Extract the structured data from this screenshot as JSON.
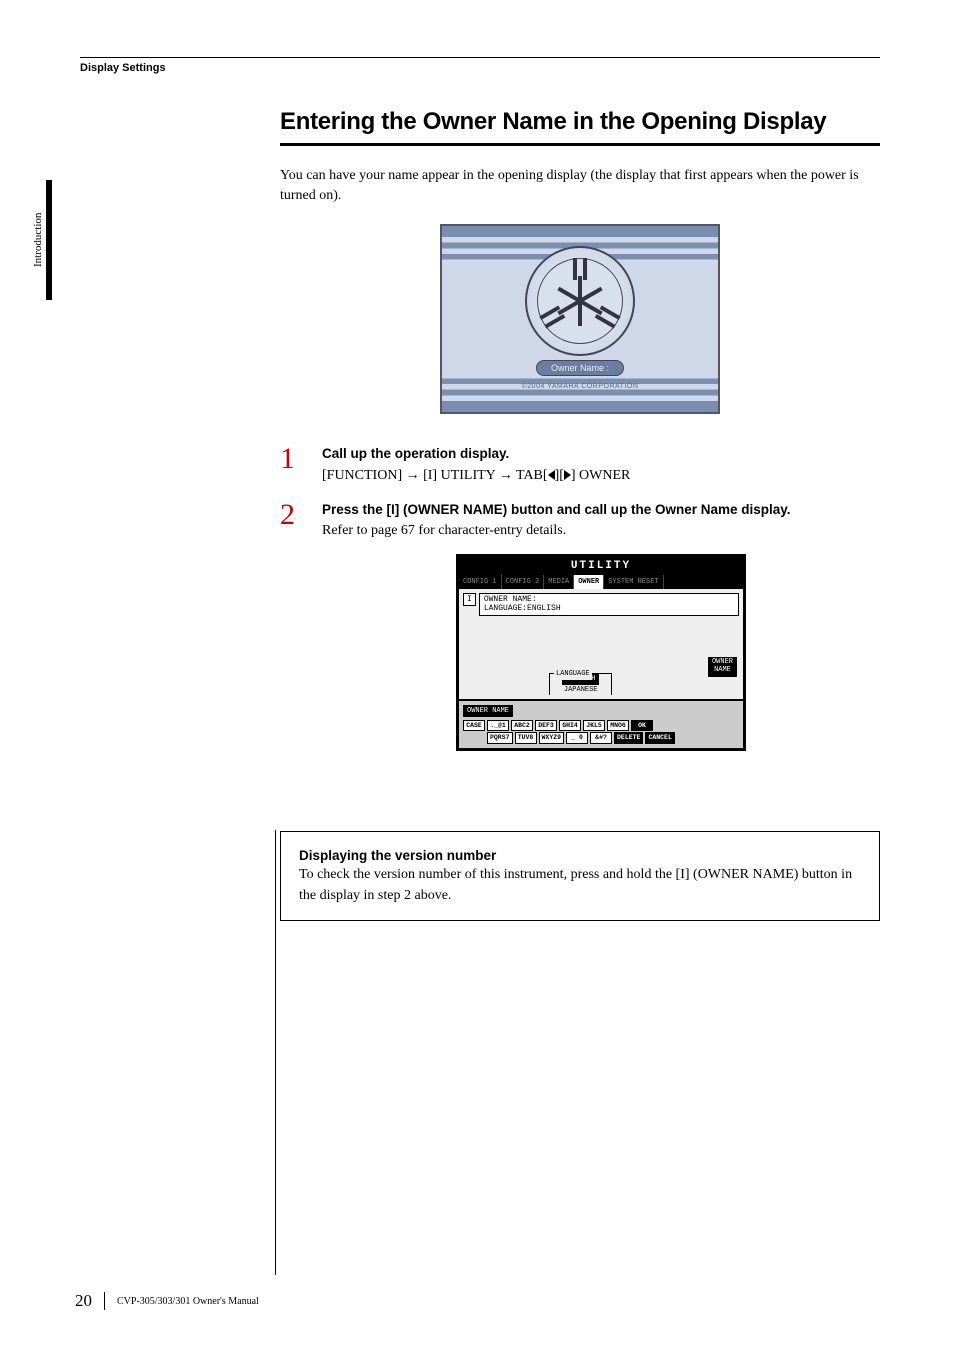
{
  "header": {
    "section_label": "Display Settings"
  },
  "side_tab": "Introduction",
  "heading": "Entering the Owner Name in the Opening Display",
  "intro": "You can have your name appear in the opening display (the display that first appears when the power is turned on).",
  "opening_display": {
    "owner_name_label": "Owner Name :",
    "corp": "©2004 YAMAHA CORPORATION"
  },
  "steps": [
    {
      "num": "1",
      "title": "Call up the operation display.",
      "path_prefix": "[FUNCTION] → [I] UTILITY → TAB[",
      "path_mid": "][",
      "path_suffix": "] OWNER"
    },
    {
      "num": "2",
      "title": "Press the [I] (OWNER NAME) button and call up the Owner Name display.",
      "body": "Refer to page 67 for character-entry details."
    }
  ],
  "utility": {
    "title": "UTILITY",
    "tabs": [
      "CONFIG 1",
      "CONFIG 2",
      "MEDIA",
      "OWNER",
      "SYSTEM RESET"
    ],
    "active_tab": "OWNER",
    "field_index": "I",
    "owner_name_label": "OWNER NAME:",
    "language_label": "LANGUAGE:ENGLISH",
    "lang_box_label": "LANGUAGE",
    "lang_opt1": "ENGLISH",
    "lang_opt2": "JAPANESE",
    "owner_button_l1": "OWNER",
    "owner_button_l2": "NAME",
    "footer_label": "OWNER NAME",
    "keys_row1": [
      "CASE",
      "._@1",
      "ABC2",
      "DEF3",
      "GHI4",
      "JKL5",
      "MNO6",
      "OK"
    ],
    "keys_row2": [
      "",
      "PQRS7",
      "TUV8",
      "WXYZ9",
      "_ 0",
      "&#?",
      "DELETE",
      "CANCEL"
    ]
  },
  "note": {
    "title": "Displaying the version number",
    "body": "To check the version number of this instrument, press and hold the [I] (OWNER NAME) button in the display in step 2 above."
  },
  "footer": {
    "page": "20",
    "manual": "CVP-305/303/301 Owner's Manual"
  }
}
